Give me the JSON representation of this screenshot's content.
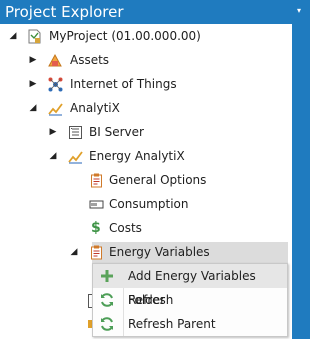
{
  "panel": {
    "title": "Project Explorer",
    "pin_glyph": "▾"
  },
  "tree": {
    "root": {
      "label": "MyProject (01.00.000.00)",
      "icon": "project-icon"
    },
    "assets": {
      "label": "Assets",
      "icon": "assets-icon"
    },
    "iot": {
      "label": "Internet of Things",
      "icon": "iot-icon"
    },
    "analytix": {
      "label": "AnalytiX",
      "icon": "analytix-icon"
    },
    "bi_server": {
      "label": "BI Server",
      "icon": "bi-server-icon"
    },
    "energy_analytix": {
      "label": "Energy AnalytiX",
      "icon": "analytix-icon"
    },
    "general_options": {
      "label": "General Options",
      "icon": "clipboard-icon"
    },
    "consumption": {
      "label": "Consumption",
      "icon": "meter-icon"
    },
    "costs": {
      "label": "Costs",
      "icon": "dollar-icon"
    },
    "energy_variables": {
      "label": "Energy Variables",
      "icon": "clipboard-icon"
    }
  },
  "context_menu": {
    "items": [
      {
        "label": "Add Energy Variables Folder",
        "icon": "plus-icon"
      },
      {
        "label": "Refresh",
        "icon": "refresh-icon"
      },
      {
        "label": "Refresh Parent",
        "icon": "refresh-icon"
      }
    ]
  },
  "colors": {
    "title_bar": "#1f7bbf",
    "selection": "#dcdcdc",
    "menu_hover": "#e6e6e6",
    "plus_green": "#5aa35a",
    "refresh_green": "#4d9e57"
  }
}
